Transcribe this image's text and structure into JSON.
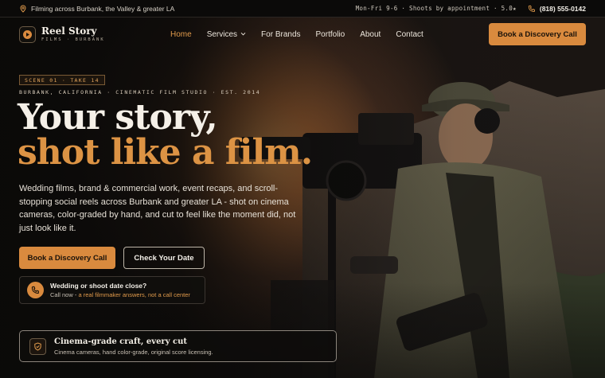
{
  "topbar": {
    "location": "Filming across Burbank, the Valley & greater LA",
    "hours": "Mon-Fri 9-6 · Shoots by appointment · 5.0★",
    "phone": "(818) 555-0142"
  },
  "brand": {
    "name": "Reel Story",
    "tagline": "FILMS · BURBANK",
    "accent": "#d98a3e"
  },
  "nav": {
    "items": [
      {
        "label": "Home",
        "active": true
      },
      {
        "label": "Services",
        "has_dropdown": true
      },
      {
        "label": "For Brands"
      },
      {
        "label": "Portfolio"
      },
      {
        "label": "About"
      },
      {
        "label": "Contact"
      }
    ],
    "cta": "Book a Discovery Call"
  },
  "hero": {
    "scene_tag": "SCENE 01 · TAKE 14",
    "eyebrow": "BURBANK, CALIFORNIA · CINEMATIC FILM STUDIO · EST. 2014",
    "headline_line1": "Your story,",
    "headline_line2": "shot like a film.",
    "lead": "Wedding films, brand & commercial work, event recaps, and scroll-stopping social reels across Burbank and greater LA - shot on cinema cameras, color-graded by hand, and cut to feel like the moment did, not just look like it.",
    "primary_button": "Book a Discovery Call",
    "secondary_button": "Check Your Date",
    "callout_title": "Wedding or shoot date close?",
    "callout_prefix": "Call now - ",
    "callout_highlight": "a real filmmaker answers, not a call center"
  },
  "feature": {
    "title": "Cinema-grade craft, every cut",
    "subtitle": "Cinema cameras, hand color-grade, original score licensing."
  },
  "icons": {
    "location": "map-pin-icon",
    "phone": "phone-icon",
    "logo": "film-reel-icon",
    "chevron": "chevron-down-icon",
    "shield": "shield-icon"
  }
}
